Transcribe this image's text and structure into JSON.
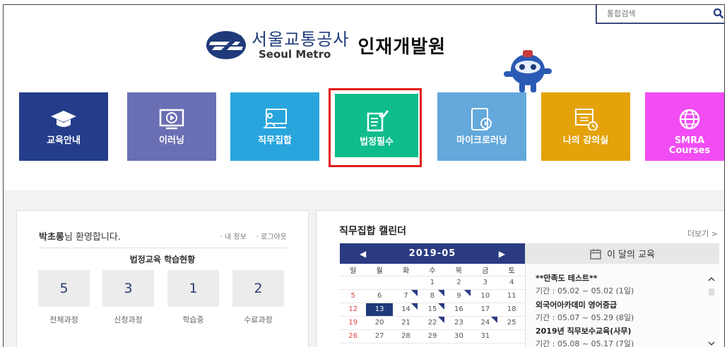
{
  "search": {
    "placeholder": "통합검색",
    "icon": "search-icon"
  },
  "logo": {
    "korean": "서울교통공사",
    "english": "Seoul Metro",
    "title": "인재개발원"
  },
  "nav_tiles": [
    {
      "label": "교육안내",
      "color": "#243d8a",
      "icon": "graduation-cap-icon"
    },
    {
      "label": "이러닝",
      "color": "#6a6fb4",
      "icon": "play-screen-icon"
    },
    {
      "label": "직무집합",
      "color": "#29a5dd",
      "icon": "classroom-icon"
    },
    {
      "label": "법정필수",
      "color": "#0fbc8c",
      "icon": "checklist-icon"
    },
    {
      "label": "마이크로러닝",
      "color": "#64a8dc",
      "icon": "tablet-icon"
    },
    {
      "label": "나의 강의실",
      "color": "#e4a20b",
      "icon": "calendar-clock-icon"
    },
    {
      "label": "SMRA\nCourses",
      "color": "#f24cf4",
      "icon": "globe-icon"
    }
  ],
  "user_panel": {
    "user_name": "박초롱",
    "welcome_suffix": "님 환영합니다.",
    "link_myinfo": "· 내 정보",
    "link_logout": "· 로그아웃",
    "status_title": "법정교육 학습현황",
    "stats": [
      {
        "value": "5",
        "label": "전체과정"
      },
      {
        "value": "3",
        "label": "신청과정"
      },
      {
        "value": "1",
        "label": "학습중"
      },
      {
        "value": "2",
        "label": "수료과정"
      }
    ]
  },
  "calendar": {
    "title": "직무집합 캘린더",
    "more": "더보기 >",
    "month": "2019-05",
    "prev": "◀",
    "next": "▶",
    "weekdays": [
      "일",
      "월",
      "화",
      "수",
      "목",
      "금",
      "토"
    ],
    "weeks": [
      [
        "",
        "",
        "",
        "1",
        "2",
        "3",
        "4"
      ],
      [
        "5",
        "6",
        "7",
        "8",
        "9",
        "10",
        "11"
      ],
      [
        "12",
        "13",
        "14",
        "15",
        "16",
        "17",
        "18"
      ],
      [
        "19",
        "20",
        "21",
        "22",
        "23",
        "24",
        "25"
      ],
      [
        "26",
        "27",
        "28",
        "29",
        "30",
        "31",
        ""
      ]
    ],
    "selected_day": "13",
    "marked_days": [
      "7",
      "8",
      "9",
      "14",
      "15",
      "22",
      "24"
    ]
  },
  "month_education": {
    "title": "이 달의 교육",
    "items": [
      {
        "name": "**만족도 테스트**",
        "period": "기간 : 05.02 ~ 05.02 (1일)"
      },
      {
        "name": "외국어아카데미 영어중급",
        "period": "기간 : 05.07 ~ 05.29 (8일)"
      },
      {
        "name": "2019년 직무보수교육(사무)",
        "period": "기간 : 05.08 ~ 05.17 (7일)"
      }
    ]
  }
}
